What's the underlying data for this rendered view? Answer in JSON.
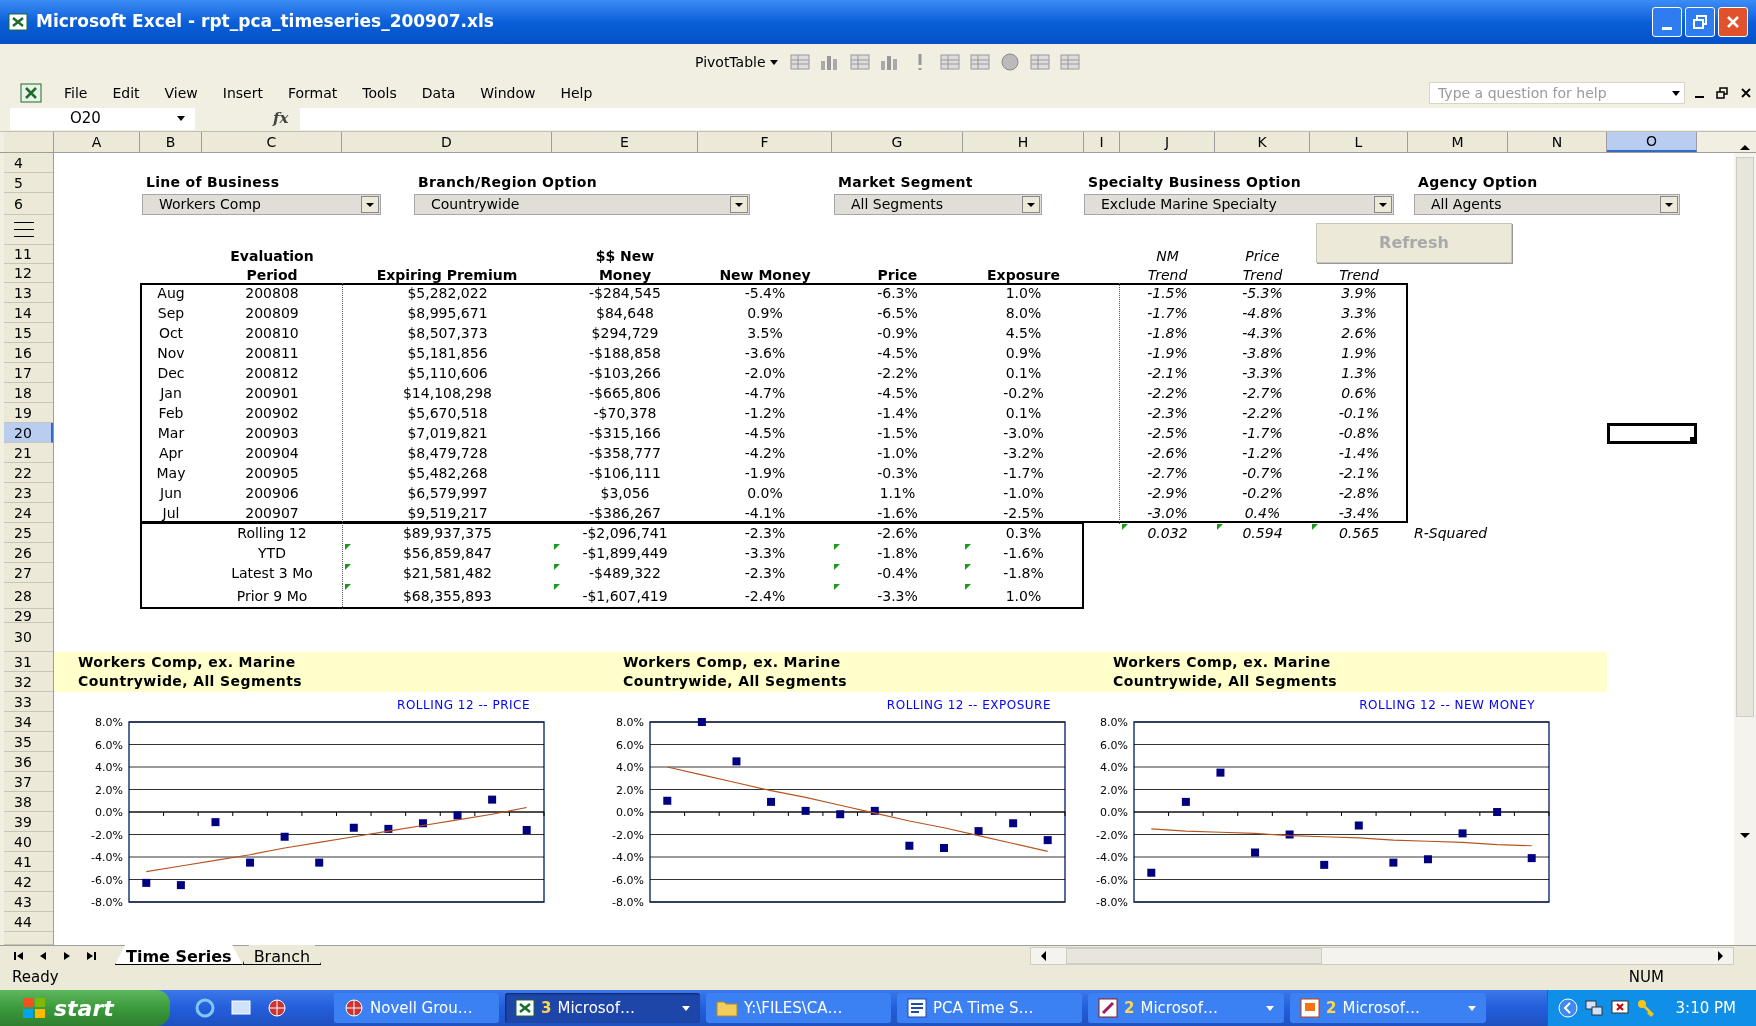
{
  "window": {
    "title": "Microsoft Excel - rpt_pca_timeseries_200907.xls"
  },
  "pivot_toolbar": {
    "label": "PivotTable"
  },
  "menu": [
    {
      "label": "File"
    },
    {
      "label": "Edit"
    },
    {
      "label": "View"
    },
    {
      "label": "Insert"
    },
    {
      "label": "Format"
    },
    {
      "label": "Tools"
    },
    {
      "label": "Data"
    },
    {
      "label": "Window"
    },
    {
      "label": "Help"
    }
  ],
  "help_box": {
    "placeholder": "Type a question for help"
  },
  "formula_bar": {
    "name_box": "O20",
    "fx": "fx"
  },
  "columns": [
    {
      "label": "A",
      "selected": false
    },
    {
      "label": "B",
      "selected": false
    },
    {
      "label": "C",
      "selected": false
    },
    {
      "label": "D",
      "selected": false
    },
    {
      "label": "E",
      "selected": false
    },
    {
      "label": "F",
      "selected": false
    },
    {
      "label": "G",
      "selected": false
    },
    {
      "label": "H",
      "selected": false
    },
    {
      "label": "I",
      "selected": false
    },
    {
      "label": "J",
      "selected": false
    },
    {
      "label": "K",
      "selected": false
    },
    {
      "label": "L",
      "selected": false
    },
    {
      "label": "M",
      "selected": false
    },
    {
      "label": "N",
      "selected": false
    },
    {
      "label": "O",
      "selected": true
    }
  ],
  "row_headers": [
    {
      "label": "4",
      "selected": false
    },
    {
      "label": "5",
      "selected": false
    },
    {
      "label": "6",
      "selected": false
    },
    {
      "selected": false
    },
    {
      "label": "11",
      "selected": false
    },
    {
      "label": "12",
      "selected": false
    },
    {
      "label": "13",
      "selected": false
    },
    {
      "label": "14",
      "selected": false
    },
    {
      "label": "15",
      "selected": false
    },
    {
      "label": "16",
      "selected": false
    },
    {
      "label": "17",
      "selected": false
    },
    {
      "label": "18",
      "selected": false
    },
    {
      "label": "19",
      "selected": false
    },
    {
      "label": "20",
      "selected": true
    },
    {
      "label": "21",
      "selected": false
    },
    {
      "label": "22",
      "selected": false
    },
    {
      "label": "23",
      "selected": false
    },
    {
      "label": "24",
      "selected": false
    },
    {
      "label": "25",
      "selected": false
    },
    {
      "label": "26",
      "selected": false
    },
    {
      "label": "27",
      "selected": false
    },
    {
      "label": "28",
      "selected": false
    },
    {
      "label": "29",
      "selected": false
    },
    {
      "label": "30",
      "selected": false
    },
    {
      "label": "31",
      "selected": false
    },
    {
      "label": "32",
      "selected": false
    },
    {
      "label": "33",
      "selected": false
    },
    {
      "label": "34",
      "selected": false
    },
    {
      "label": "35",
      "selected": false
    },
    {
      "label": "36",
      "selected": false
    },
    {
      "label": "37",
      "selected": false
    },
    {
      "label": "38",
      "selected": false
    },
    {
      "label": "39",
      "selected": false
    },
    {
      "label": "40",
      "selected": false
    },
    {
      "label": "41",
      "selected": false
    },
    {
      "label": "42",
      "selected": false
    },
    {
      "label": "43",
      "selected": false
    },
    {
      "label": "44",
      "selected": false
    },
    {
      "selected": false
    }
  ],
  "filters": [
    {
      "label": "Line of Business",
      "value": "Workers Comp"
    },
    {
      "label": "Branch/Region Option",
      "value": "Countrywide"
    },
    {
      "label": "Market Segment",
      "value": "All Segments"
    },
    {
      "label": "Specialty Business Option",
      "value": "Exclude Marine Specialty"
    },
    {
      "label": "Agency Option",
      "value": "All Agents"
    }
  ],
  "refresh_button": {
    "label": "Refresh",
    "disabled": true
  },
  "table": {
    "header_rows": [
      {
        "C": "Evaluation",
        "E": "$$ New",
        "J": "NM",
        "K": "Price"
      },
      {
        "C": "Period",
        "D": "Expiring Premium",
        "E": "Money",
        "F": "New Money",
        "G": "Price",
        "H": "Exposure",
        "J": "Trend",
        "K": "Trend",
        "L": "Trend"
      }
    ],
    "rows": [
      {
        "selected": false,
        "cells": {
          "B": "Aug",
          "C": "200808",
          "D": "$5,282,022",
          "E": "-$284,545",
          "F": "-5.4%",
          "G": "-6.3%",
          "H": "1.0%",
          "J": "-1.5%",
          "K": "-5.3%",
          "L": "3.9%"
        }
      },
      {
        "selected": false,
        "cells": {
          "B": "Sep",
          "C": "200809",
          "D": "$8,995,671",
          "E": "$84,648",
          "F": "0.9%",
          "G": "-6.5%",
          "H": "8.0%",
          "J": "-1.7%",
          "K": "-4.8%",
          "L": "3.3%"
        }
      },
      {
        "selected": false,
        "cells": {
          "B": "Oct",
          "C": "200810",
          "D": "$8,507,373",
          "E": "$294,729",
          "F": "3.5%",
          "G": "-0.9%",
          "H": "4.5%",
          "J": "-1.8%",
          "K": "-4.3%",
          "L": "2.6%"
        }
      },
      {
        "selected": false,
        "cells": {
          "B": "Nov",
          "C": "200811",
          "D": "$5,181,856",
          "E": "-$188,858",
          "F": "-3.6%",
          "G": "-4.5%",
          "H": "0.9%",
          "J": "-1.9%",
          "K": "-3.8%",
          "L": "1.9%"
        }
      },
      {
        "selected": false,
        "cells": {
          "B": "Dec",
          "C": "200812",
          "D": "$5,110,606",
          "E": "-$103,266",
          "F": "-2.0%",
          "G": "-2.2%",
          "H": "0.1%",
          "J": "-2.1%",
          "K": "-3.3%",
          "L": "1.3%"
        }
      },
      {
        "selected": false,
        "cells": {
          "B": "Jan",
          "C": "200901",
          "D": "$14,108,298",
          "E": "-$665,806",
          "F": "-4.7%",
          "G": "-4.5%",
          "H": "-0.2%",
          "J": "-2.2%",
          "K": "-2.7%",
          "L": "0.6%"
        }
      },
      {
        "selected": false,
        "cells": {
          "B": "Feb",
          "C": "200902",
          "D": "$5,670,518",
          "E": "-$70,378",
          "F": "-1.2%",
          "G": "-1.4%",
          "H": "0.1%",
          "J": "-2.3%",
          "K": "-2.2%",
          "L": "-0.1%"
        }
      },
      {
        "selected": true,
        "cells": {
          "B": "Mar",
          "C": "200903",
          "D": "$7,019,821",
          "E": "-$315,166",
          "F": "-4.5%",
          "G": "-1.5%",
          "H": "-3.0%",
          "J": "-2.5%",
          "K": "-1.7%",
          "L": "-0.8%"
        }
      },
      {
        "selected": false,
        "cells": {
          "B": "Apr",
          "C": "200904",
          "D": "$8,479,728",
          "E": "-$358,777",
          "F": "-4.2%",
          "G": "-1.0%",
          "H": "-3.2%",
          "J": "-2.6%",
          "K": "-1.2%",
          "L": "-1.4%"
        }
      },
      {
        "selected": false,
        "cells": {
          "B": "May",
          "C": "200905",
          "D": "$5,482,268",
          "E": "-$106,111",
          "F": "-1.9%",
          "G": "-0.3%",
          "H": "-1.7%",
          "J": "-2.7%",
          "K": "-0.7%",
          "L": "-2.1%"
        }
      },
      {
        "selected": false,
        "cells": {
          "B": "Jun",
          "C": "200906",
          "D": "$6,579,997",
          "E": "$3,056",
          "F": "0.0%",
          "G": "1.1%",
          "H": "-1.0%",
          "J": "-2.9%",
          "K": "-0.2%",
          "L": "-2.8%"
        }
      },
      {
        "selected": false,
        "cells": {
          "B": "Jul",
          "C": "200907",
          "D": "$9,519,217",
          "E": "-$386,267",
          "F": "-4.1%",
          "G": "-1.6%",
          "H": "-2.5%",
          "J": "-3.0%",
          "K": "0.4%",
          "L": "-3.4%"
        }
      }
    ],
    "summary_rows": [
      {
        "flagged": {
          "J": true,
          "K": true,
          "L": true
        },
        "cells": {
          "C": "Rolling 12",
          "D": "$89,937,375",
          "E": "-$2,096,741",
          "F": "-2.3%",
          "G": "-2.6%",
          "H": "0.3%",
          "J": "0.032",
          "K": "0.594",
          "L": "0.565",
          "M": "R-Squared"
        }
      },
      {
        "flagged": {
          "D": true,
          "E": true,
          "G": true,
          "H": true
        },
        "cells": {
          "C": "YTD",
          "D": "$56,859,847",
          "E": "-$1,899,449",
          "F": "-3.3%",
          "G": "-1.8%",
          "H": "-1.6%"
        }
      },
      {
        "flagged": {
          "D": true,
          "E": true,
          "G": true,
          "H": true
        },
        "cells": {
          "C": "Latest 3 Mo",
          "D": "$21,581,482",
          "E": "-$489,322",
          "F": "-2.3%",
          "G": "-0.4%",
          "H": "-1.8%"
        }
      },
      {
        "flagged": {
          "D": true,
          "E": true,
          "G": true,
          "H": true
        },
        "cells": {
          "C": "Prior 9 Mo",
          "D": "$68,355,893",
          "E": "-$1,607,419",
          "F": "-2.4%",
          "G": "-3.3%",
          "H": "1.0%"
        }
      }
    ]
  },
  "charts": [
    {
      "heading": [
        "Workers Comp, ex. Marine",
        "Countrywide, All Segments"
      ],
      "chart_data": {
        "type": "scatter",
        "title": "ROLLING 12 -- PRICE",
        "ylim": [
          -8,
          8
        ],
        "yticks": [
          {
            "value": 8,
            "label": "8.0%"
          },
          {
            "value": 6,
            "label": "6.0%"
          },
          {
            "value": 4,
            "label": "4.0%"
          },
          {
            "value": 2,
            "label": "2.0%"
          },
          {
            "value": 0,
            "label": "0.0%"
          },
          {
            "value": -2,
            "label": "-2.0%"
          },
          {
            "value": -4,
            "label": "-4.0%"
          },
          {
            "value": -6,
            "label": "-6.0%"
          },
          {
            "value": -8,
            "label": "-8.0%"
          }
        ],
        "series": [
          {
            "type": "scatter",
            "color": "#000080",
            "values": [
              -6.3,
              -6.5,
              -0.9,
              -4.5,
              -2.2,
              -4.5,
              -1.4,
              -1.5,
              -1.0,
              -0.3,
              1.1,
              -1.6
            ]
          },
          {
            "type": "line",
            "color": "#b5541f",
            "values": [
              -5.3,
              -4.8,
              -4.3,
              -3.8,
              -3.2,
              -2.7,
              -2.2,
              -1.7,
              -1.2,
              -0.7,
              -0.2,
              0.4
            ]
          }
        ],
        "grid": true
      }
    },
    {
      "heading": [
        "Workers Comp, ex. Marine",
        "Countrywide, All Segments"
      ],
      "chart_data": {
        "type": "scatter",
        "title": "ROLLING 12 -- EXPOSURE",
        "ylim": [
          -8,
          8
        ],
        "yticks": [
          {
            "value": 8,
            "label": "8.0%"
          },
          {
            "value": 6,
            "label": "6.0%"
          },
          {
            "value": 4,
            "label": "4.0%"
          },
          {
            "value": 2,
            "label": "2.0%"
          },
          {
            "value": 0,
            "label": "0.0%"
          },
          {
            "value": -2,
            "label": "-2.0%"
          },
          {
            "value": -4,
            "label": "-4.0%"
          },
          {
            "value": -6,
            "label": "-6.0%"
          },
          {
            "value": -8,
            "label": "-8.0%"
          }
        ],
        "series": [
          {
            "type": "scatter",
            "color": "#000080",
            "values": [
              1.0,
              8.0,
              4.5,
              0.9,
              0.1,
              -0.2,
              0.1,
              -3.0,
              -3.2,
              -1.7,
              -1.0,
              -2.5
            ]
          },
          {
            "type": "line",
            "color": "#b5541f",
            "values": [
              4.0,
              3.3,
              2.6,
              1.9,
              1.3,
              0.6,
              -0.1,
              -0.8,
              -1.4,
              -2.1,
              -2.8,
              -3.5
            ]
          }
        ],
        "grid": true
      }
    },
    {
      "heading": [
        "Workers Comp, ex. Marine",
        "Countrywide, All Segments"
      ],
      "chart_data": {
        "type": "scatter",
        "title": "ROLLING 12 -- NEW MONEY",
        "ylim": [
          -8,
          8
        ],
        "yticks": [
          {
            "value": 8,
            "label": "8.0%"
          },
          {
            "value": 6,
            "label": "6.0%"
          },
          {
            "value": 4,
            "label": "4.0%"
          },
          {
            "value": 2,
            "label": "2.0%"
          },
          {
            "value": 0,
            "label": "0.0%"
          },
          {
            "value": -2,
            "label": "-2.0%"
          },
          {
            "value": -4,
            "label": "-4.0%"
          },
          {
            "value": -6,
            "label": "-6.0%"
          },
          {
            "value": -8,
            "label": "-8.0%"
          }
        ],
        "series": [
          {
            "type": "scatter",
            "color": "#000080",
            "values": [
              -5.4,
              0.9,
              3.5,
              -3.6,
              -2.0,
              -4.7,
              -1.2,
              -4.5,
              -4.2,
              -1.9,
              0.0,
              -4.1
            ]
          },
          {
            "type": "line",
            "color": "#b5541f",
            "values": [
              -1.5,
              -1.7,
              -1.8,
              -1.9,
              -2.1,
              -2.2,
              -2.3,
              -2.5,
              -2.6,
              -2.7,
              -2.9,
              -3.0
            ]
          }
        ],
        "grid": true
      }
    }
  ],
  "sheet_tabs": [
    {
      "label": "Time Series",
      "selected": true
    },
    {
      "label": "Branch",
      "selected": false
    }
  ],
  "status_bar": {
    "left": "Ready",
    "right": "NUM"
  },
  "taskbar": {
    "start": "start",
    "tasks": [
      {
        "kind": "globe",
        "label": "Novell Grou…",
        "selected": false,
        "menu": false
      },
      {
        "kind": "sheet",
        "count": "3",
        "label": "Microsof…",
        "selected": true,
        "menu": true
      },
      {
        "kind": "folder",
        "label": "Y:\\FILES\\CA…",
        "selected": false,
        "menu": false
      },
      {
        "kind": "doc",
        "label": "PCA Time S…",
        "selected": false,
        "menu": false
      },
      {
        "kind": "app",
        "count": "2",
        "label": "Microsof…",
        "selected": false,
        "menu": true
      },
      {
        "kind": "slides",
        "count": "2",
        "label": "Microsof…",
        "selected": false,
        "menu": true
      }
    ],
    "clock": "3:10 PM"
  }
}
